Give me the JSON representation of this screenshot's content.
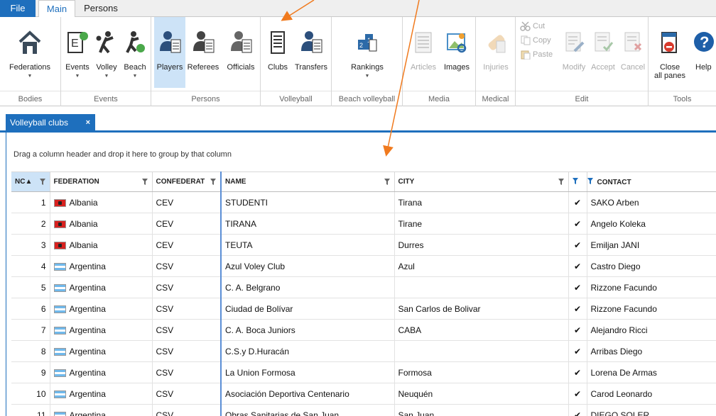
{
  "ribbon_tabs": [
    "File",
    "Main",
    "Persons"
  ],
  "groups": {
    "bodies": "Bodies",
    "events": "Events",
    "persons": "Persons",
    "volleyball": "Volleyball",
    "beach": "Beach volleyball",
    "media": "Media",
    "medical": "Medical",
    "edit": "Edit",
    "tools": "Tools"
  },
  "buttons": {
    "federations": "Federations",
    "events": "Events",
    "volley": "Volley",
    "beach": "Beach",
    "players": "Players",
    "referees": "Referees",
    "officials": "Officials",
    "clubs": "Clubs",
    "transfers": "Transfers",
    "rankings": "Rankings",
    "articles": "Articles",
    "images": "Images",
    "injuries": "Injuries",
    "cut": "Cut",
    "copy": "Copy",
    "paste": "Paste",
    "modify": "Modify",
    "accept": "Accept",
    "cancel": "Cancel",
    "close_line1": "Close",
    "close_line2": "all panes",
    "help": "Help"
  },
  "doc_tab": {
    "title": "Volleyball clubs",
    "close": "×"
  },
  "group_hint": "Drag a column header and drop it here to group by that column",
  "columns": {
    "nc": "NC▲",
    "federation": "FEDERATION",
    "confederation": "CONFEDERAT",
    "name": "NAME",
    "city": "CITY",
    "contact": "CONTACT"
  },
  "check_glyph": "✔",
  "rows": [
    {
      "nc": "1",
      "flag": "al",
      "federation": "Albania",
      "conf": "CEV",
      "name": "STUDENTI",
      "city": "Tirana",
      "contact": "SAKO Arben"
    },
    {
      "nc": "2",
      "flag": "al",
      "federation": "Albania",
      "conf": "CEV",
      "name": "TIRANA",
      "city": "Tirane",
      "contact": "Angelo Koleka"
    },
    {
      "nc": "3",
      "flag": "al",
      "federation": "Albania",
      "conf": "CEV",
      "name": "TEUTA",
      "city": "Durres",
      "contact": "Emiljan JANI"
    },
    {
      "nc": "4",
      "flag": "ar",
      "federation": "Argentina",
      "conf": "CSV",
      "name": "Azul Voley Club",
      "city": "Azul",
      "contact": "Castro Diego"
    },
    {
      "nc": "5",
      "flag": "ar",
      "federation": "Argentina",
      "conf": "CSV",
      "name": "C. A. Belgrano",
      "city": "",
      "contact": "Rizzone Facundo"
    },
    {
      "nc": "6",
      "flag": "ar",
      "federation": "Argentina",
      "conf": "CSV",
      "name": "Ciudad de Bolívar",
      "city": "San Carlos de Bolivar",
      "contact": "Rizzone Facundo"
    },
    {
      "nc": "7",
      "flag": "ar",
      "federation": "Argentina",
      "conf": "CSV",
      "name": "C. A. Boca Juniors",
      "city": "CABA",
      "contact": "Alejandro Ricci"
    },
    {
      "nc": "8",
      "flag": "ar",
      "federation": "Argentina",
      "conf": "CSV",
      "name": "C.S.y D.Huracán",
      "city": "",
      "contact": "Arribas Diego"
    },
    {
      "nc": "9",
      "flag": "ar",
      "federation": "Argentina",
      "conf": "CSV",
      "name": "La Union Formosa",
      "city": "Formosa",
      "contact": "Lorena De Armas"
    },
    {
      "nc": "10",
      "flag": "ar",
      "federation": "Argentina",
      "conf": "CSV",
      "name": "Asociación Deportiva Centenario",
      "city": "Neuquén",
      "contact": "Carod Leonardo"
    },
    {
      "nc": "11",
      "flag": "ar",
      "federation": "Argentina",
      "conf": "CSV",
      "name": "Obras Sanitarias de San Juan",
      "city": "San Juan",
      "contact": "DIEGO SOLER"
    }
  ]
}
